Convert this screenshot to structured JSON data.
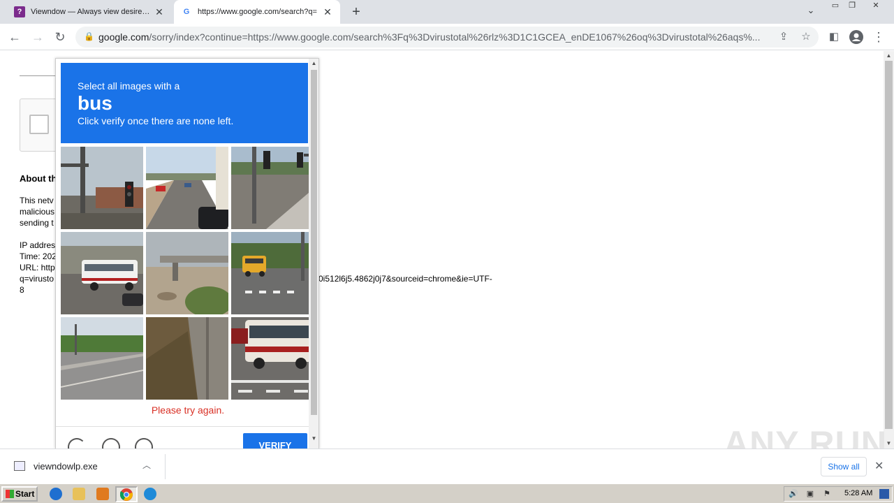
{
  "browser": {
    "tabs": [
      {
        "title": "Viewndow — Always view desired wi",
        "favicon": "viewndow-icon",
        "active": false
      },
      {
        "title": "https://www.google.com/search?q=",
        "favicon": "google-icon",
        "active": true
      }
    ],
    "address": {
      "host": "google.com",
      "path": "/sorry/index?continue=https://www.google.com/search%3Fq%3Dvirustotal%26rlz%3D1C1GCEA_enDE1067%26oq%3Dvirustotal%26aqs%..."
    }
  },
  "page": {
    "about_title": "About th",
    "lines": [
      "This netv",
      "malicious",
      "sending t",
      "IP addres",
      "Time: 202",
      "URL: http",
      "q=virusto",
      "8"
    ],
    "url_tail": "0i512l6j5.4862j0j7&sourceid=chrome&ie=UTF-"
  },
  "captcha": {
    "instruction": "Select all images with a",
    "target": "bus",
    "subtext": "Click verify once there are none left.",
    "error": "Please try again.",
    "verify_label": "VERIFY",
    "tiles": [
      "traffic-light-pole",
      "road-traffic-cars",
      "sidewalk-corner",
      "white-bus-parking",
      "overpass-desert",
      "yellow-school-bus",
      "open-road",
      "concrete-wall",
      "red-white-bus"
    ]
  },
  "downloads": {
    "filename": "viewndowlp.exe",
    "show_all": "Show all"
  },
  "watermark": "ANY RUN",
  "taskbar": {
    "start_label": "Start",
    "time": "5:28 AM"
  },
  "colors": {
    "captcha_header": "#1a73e8",
    "error_red": "#d93025"
  }
}
